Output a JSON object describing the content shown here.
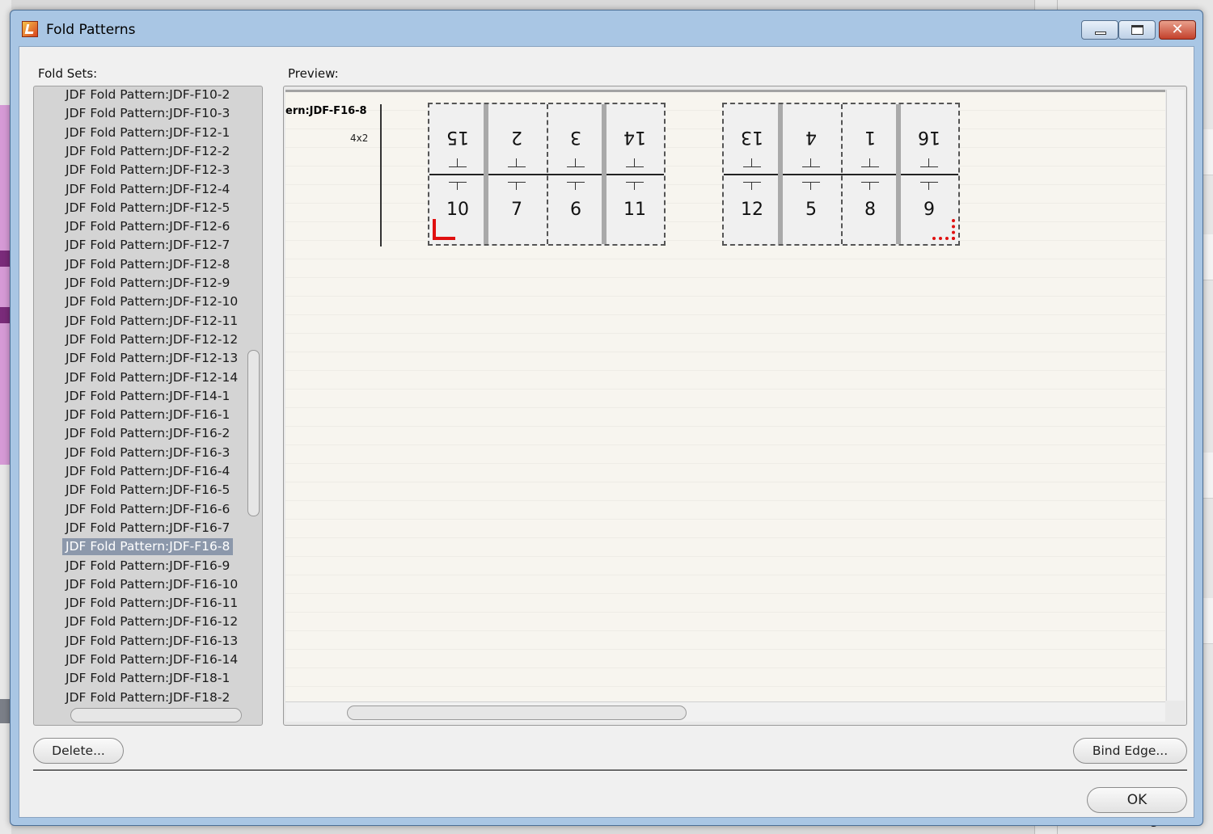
{
  "window": {
    "title": "Fold Patterns",
    "close_glyph": "✕"
  },
  "foldsets": {
    "label": "Fold Sets:",
    "items": [
      "JDF Fold Pattern:JDF-F10-2",
      "JDF Fold Pattern:JDF-F10-3",
      "JDF Fold Pattern:JDF-F12-1",
      "JDF Fold Pattern:JDF-F12-2",
      "JDF Fold Pattern:JDF-F12-3",
      "JDF Fold Pattern:JDF-F12-4",
      "JDF Fold Pattern:JDF-F12-5",
      "JDF Fold Pattern:JDF-F12-6",
      "JDF Fold Pattern:JDF-F12-7",
      "JDF Fold Pattern:JDF-F12-8",
      "JDF Fold Pattern:JDF-F12-9",
      "JDF Fold Pattern:JDF-F12-10",
      "JDF Fold Pattern:JDF-F12-11",
      "JDF Fold Pattern:JDF-F12-12",
      "JDF Fold Pattern:JDF-F12-13",
      "JDF Fold Pattern:JDF-F12-14",
      "JDF Fold Pattern:JDF-F14-1",
      "JDF Fold Pattern:JDF-F16-1",
      "JDF Fold Pattern:JDF-F16-2",
      "JDF Fold Pattern:JDF-F16-3",
      "JDF Fold Pattern:JDF-F16-4",
      "JDF Fold Pattern:JDF-F16-5",
      "JDF Fold Pattern:JDF-F16-6",
      "JDF Fold Pattern:JDF-F16-7",
      "JDF Fold Pattern:JDF-F16-8",
      "JDF Fold Pattern:JDF-F16-9",
      "JDF Fold Pattern:JDF-F16-10",
      "JDF Fold Pattern:JDF-F16-11",
      "JDF Fold Pattern:JDF-F16-12",
      "JDF Fold Pattern:JDF-F16-13",
      "JDF Fold Pattern:JDF-F16-14",
      "JDF Fold Pattern:JDF-F18-1",
      "JDF Fold Pattern:JDF-F18-2"
    ],
    "selected_index": 24
  },
  "preview": {
    "label": "Preview:",
    "pattern_name": "ern:JDF-F16-8",
    "layout": "4x2",
    "sheets": [
      {
        "top_pages": [
          "15",
          "2",
          "3",
          "14"
        ],
        "bottom_pages": [
          "10",
          "7",
          "6",
          "11"
        ]
      },
      {
        "top_pages": [
          "13",
          "4",
          "1",
          "16"
        ],
        "bottom_pages": [
          "12",
          "5",
          "8",
          "9"
        ]
      }
    ],
    "marker_color": "#e01010"
  },
  "buttons": {
    "delete": "Delete...",
    "bind_edge": "Bind Edge...",
    "ok": "OK"
  },
  "background": {
    "right_button_fragment": "Bind Edge..."
  }
}
